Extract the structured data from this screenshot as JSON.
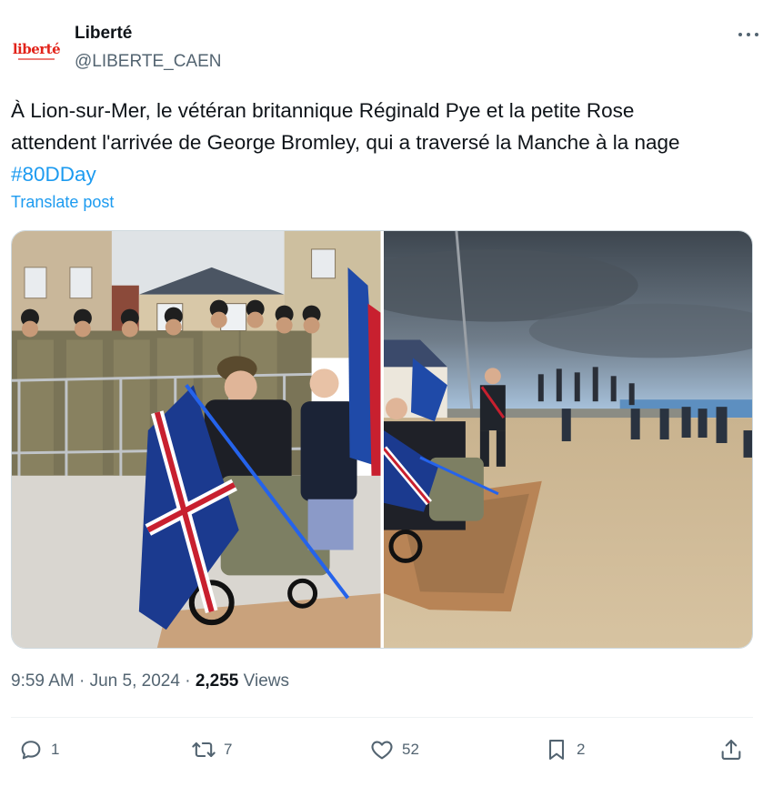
{
  "author": {
    "name": "Liberté",
    "handle": "@LIBERTE_CAEN",
    "avatar_logo_text": "liberté"
  },
  "tweet": {
    "text_line1": "À Lion-sur-Mer, le vétéran britannique Réginald Pye et la petite Rose",
    "text_line2": "attendent l'arrivée de George Bromley, qui a traversé la Manche à la nage",
    "hashtag": "#80DDay",
    "translate_label": "Translate post"
  },
  "media": {
    "photos": [
      {
        "icon": "photo-veteran-with-union-flag-and-soldiers"
      },
      {
        "icon": "photo-beach-crowd-awaiting-swimmer"
      }
    ]
  },
  "meta": {
    "time": "9:59 AM",
    "sep1": "·",
    "date": "Jun 5, 2024",
    "sep2": "·",
    "views_count": "2,255",
    "views_label": "Views"
  },
  "actions": {
    "reply_count": "1",
    "repost_count": "7",
    "like_count": "52",
    "bookmark_count": "2"
  },
  "colors": {
    "accent": "#1d9bf0",
    "secondary_text": "#536471",
    "primary_text": "#0f1419",
    "brand_red": "#e2231a"
  }
}
